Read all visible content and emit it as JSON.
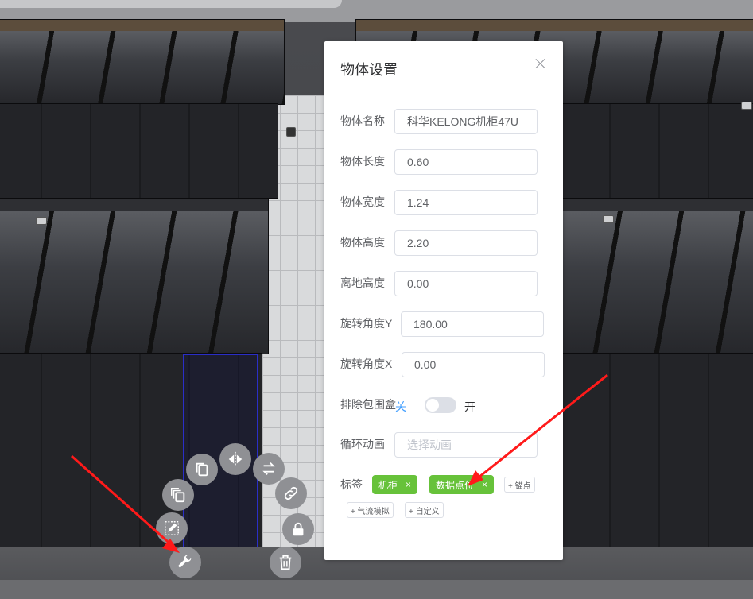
{
  "dialog": {
    "title": "物体设置",
    "fields": {
      "name": {
        "label": "物体名称",
        "value": "科华KELONG机柜47U"
      },
      "length": {
        "label": "物体长度",
        "value": "0.60"
      },
      "width": {
        "label": "物体宽度",
        "value": "1.24"
      },
      "height": {
        "label": "物体高度",
        "value": "2.20"
      },
      "ground_height": {
        "label": "离地高度",
        "value": "0.00"
      },
      "rotate_y": {
        "label": "旋转角度Y",
        "value": "180.00"
      },
      "rotate_x": {
        "label": "旋转角度X",
        "value": "0.00"
      }
    },
    "bbox_switch": {
      "label": "排除包围盒",
      "off_text": "关",
      "on_text": "开",
      "state": "off"
    },
    "animation": {
      "label": "循环动画",
      "placeholder": "选择动画"
    },
    "tags": {
      "label": "标签",
      "active": [
        {
          "text": "机柜",
          "remove": "×"
        },
        {
          "text": "数据点位",
          "remove": "×"
        }
      ],
      "add_options": [
        "+ 锚点",
        "+ 气流模拟",
        "+ 自定义"
      ]
    }
  },
  "tool_menu": [
    "copy-icon",
    "multi-copy-icon",
    "edit-icon",
    "wrench-icon",
    "mirror-icon",
    "swap-icon",
    "link-icon",
    "lock-icon",
    "delete-icon"
  ],
  "colors": {
    "tag_green": "#67c23a",
    "switch_blue": "#409eff",
    "selection_blue": "#2a2ec8",
    "arrow_red": "#ff1a1a"
  }
}
